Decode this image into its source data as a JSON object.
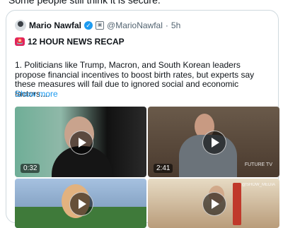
{
  "top_text": "Some people still think it is secure.",
  "post": {
    "author_name": "Mario Nawfal",
    "handle": "@MarioNawfal",
    "separator": "·",
    "time": "5h",
    "headline": "12 HOUR NEWS RECAP",
    "body": "1. Politicians like Trump, Macron, and South Korean leaders propose financial incentives to boost birth rates, but experts say these measures will fail due to ignored social and economic factors....",
    "show_more": "Show more"
  },
  "media": [
    {
      "duration": "0:32"
    },
    {
      "duration": "2:41",
      "watermark": "FUTURE TV"
    },
    {
      "duration": ""
    },
    {
      "duration": "",
      "watermark": "@SHOW_MEDIA"
    }
  ],
  "colors": {
    "link": "#1d9bf0",
    "verified": "#1d9bf0",
    "border": "#cfd9de"
  }
}
